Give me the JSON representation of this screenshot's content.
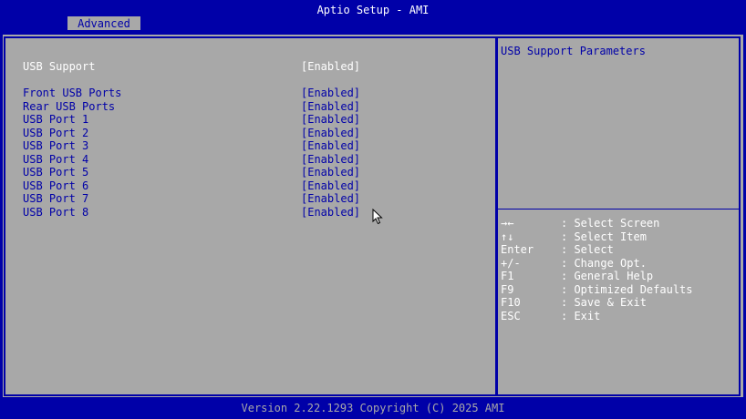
{
  "app": {
    "title": "Aptio Setup - AMI",
    "footer": "Version 2.22.1293 Copyright (C) 2025 AMI"
  },
  "tabs": [
    {
      "label": "Advanced",
      "active": true
    }
  ],
  "settings": {
    "usb_support": {
      "label": "USB Support",
      "value": "[Enabled]"
    },
    "items": [
      {
        "label": "Front USB Ports",
        "value": "[Enabled]"
      },
      {
        "label": "Rear USB Ports",
        "value": "[Enabled]"
      },
      {
        "label": "USB Port 1",
        "value": "[Enabled]"
      },
      {
        "label": "USB Port 2",
        "value": "[Enabled]"
      },
      {
        "label": "USB Port 3",
        "value": "[Enabled]"
      },
      {
        "label": "USB Port 4",
        "value": "[Enabled]"
      },
      {
        "label": "USB Port 5",
        "value": "[Enabled]"
      },
      {
        "label": "USB Port 6",
        "value": "[Enabled]"
      },
      {
        "label": "USB Port 7",
        "value": "[Enabled]"
      },
      {
        "label": "USB Port 8",
        "value": "[Enabled]"
      }
    ]
  },
  "help": {
    "title": "USB Support Parameters",
    "keys": [
      {
        "key": "→←",
        "desc": ": Select Screen"
      },
      {
        "key": "↑↓",
        "desc": ": Select Item"
      },
      {
        "key": "Enter",
        "desc": ": Select"
      },
      {
        "key": "+/-",
        "desc": ": Change Opt."
      },
      {
        "key": "F1",
        "desc": ": General Help"
      },
      {
        "key": "F9",
        "desc": ": Optimized Defaults"
      },
      {
        "key": "F10",
        "desc": ": Save & Exit"
      },
      {
        "key": "ESC",
        "desc": ": Exit"
      }
    ]
  },
  "colors": {
    "background": "#0000a8",
    "panel": "#a8a8a8",
    "text_blue": "#0000a8",
    "text_white": "#ffffff"
  },
  "icons": {
    "cursor": "mouse-pointer-icon"
  }
}
